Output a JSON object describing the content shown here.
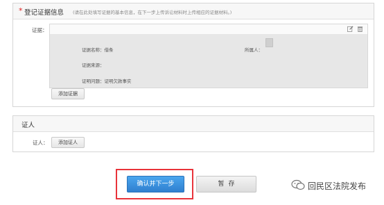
{
  "section_evidence": {
    "required_mark": "*",
    "title": "登记证据信息",
    "hint": "(请在此处填写证据的基本信息，在下一步上传诉讼材料时上传相应的证据材料。)",
    "evidence_label": "证据：",
    "fields": {
      "name_label": "证据名称：借条",
      "owner_label": "所属人：",
      "source_label": "证据来源：",
      "purpose_label": "证明问题：证明欠款事实"
    },
    "icons": {
      "edit": "edit-icon",
      "delete": "trash-icon"
    },
    "add_evidence_button": "添加证据"
  },
  "section_witness": {
    "title": "证人",
    "witness_label": "证人：",
    "add_witness_button": "添加证人"
  },
  "actions": {
    "confirm_label": "确认并下一步",
    "save_label": "暂存",
    "highlight_color": "#e8333a",
    "confirm_color": "#3b8fdc"
  },
  "watermark": {
    "icon": "wechat-icon",
    "text": "回民区法院发布"
  }
}
